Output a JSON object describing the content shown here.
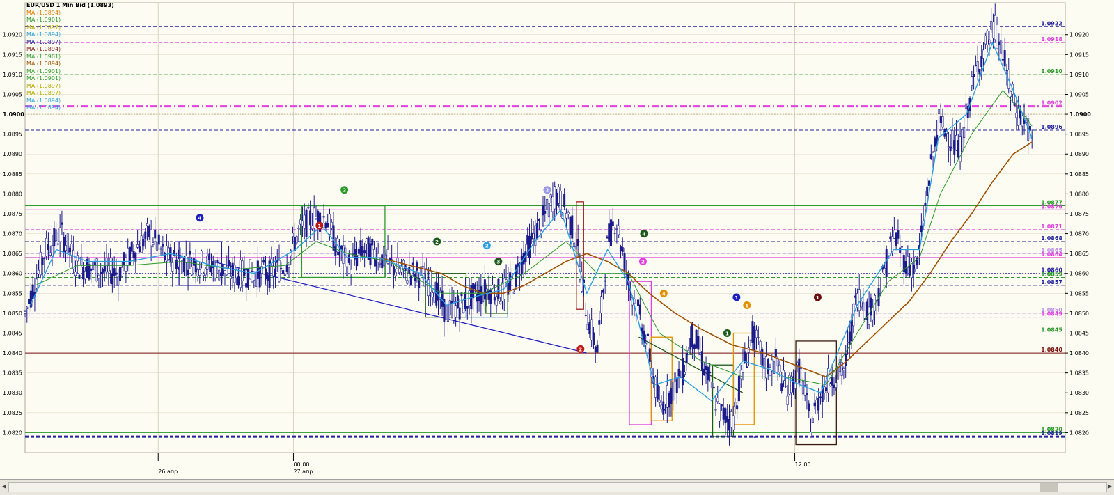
{
  "chart_data": {
    "type": "candlestick",
    "title": "EUR/USD 1 Min Bid (1.0893)",
    "ylim": [
      1.0815,
      1.0928
    ],
    "y_ticks": [
      1.082,
      1.0825,
      1.083,
      1.0835,
      1.084,
      1.0845,
      1.085,
      1.0855,
      1.086,
      1.0865,
      1.087,
      1.0875,
      1.088,
      1.0885,
      1.089,
      1.0895,
      1.09,
      1.0905,
      1.091,
      1.0915,
      1.092
    ],
    "y_tick_labels": [
      "1.0820",
      "1.0825",
      "1.0830",
      "1.0835",
      "1.0840",
      "1.0845",
      "1.0850",
      "1.0855",
      "1.0860",
      "1.0865",
      "1.0870",
      "1.0875",
      "1.0880",
      "1.0885",
      "1.0890",
      "1.0895",
      "1.0900",
      "1.0905",
      "1.0910",
      "1.0915",
      "1.0920"
    ],
    "bold_tick": "1.0900",
    "x_label_groups": [
      {
        "pos": 0.128,
        "labels": [
          "",
          "26 апр"
        ]
      },
      {
        "pos": 0.258,
        "labels": [
          "00:00",
          "27 апр"
        ]
      },
      {
        "pos": 0.74,
        "labels": [
          "12:00",
          ""
        ]
      }
    ],
    "legend": [
      {
        "text": "MA (1.0894)",
        "color": "#e07800"
      },
      {
        "text": "MA (1.0901)",
        "color": "#2a9a2a"
      },
      {
        "text": "MA (1.0897)",
        "color": "#b8a800"
      },
      {
        "text": "MA (1.0894)",
        "color": "#2aa0e0"
      },
      {
        "text": "MA (1.0897)",
        "color": "#2020a0"
      },
      {
        "text": "MA (1.0894)",
        "color": "#8a2020"
      },
      {
        "text": "MA (1.0901)",
        "color": "#2a9a2a"
      },
      {
        "text": "MA (1.0894)",
        "color": "#a05000"
      },
      {
        "text": "MA (1.0901)",
        "color": "#2a9a2a"
      },
      {
        "text": "MA (1.0901)",
        "color": "#2a9a2a"
      },
      {
        "text": "MA (1.0897)",
        "color": "#b8a800"
      },
      {
        "text": "MA (1.0897)",
        "color": "#b8a800"
      },
      {
        "text": "MA (1.0894)",
        "color": "#2aa0e0"
      },
      {
        "text": "MA (1.0894)",
        "color": "#2aa0e0"
      }
    ],
    "levels": [
      {
        "value": 1.0922,
        "label": "1.0922",
        "color": "#2020a0",
        "style": "dash",
        "width": 1
      },
      {
        "value": 1.0918,
        "label": "1.0918",
        "color": "#e040e0",
        "style": "dash",
        "width": 1
      },
      {
        "value": 1.091,
        "label": "1.0910",
        "color": "#2a9a2a",
        "style": "dash",
        "width": 1
      },
      {
        "value": 1.0902,
        "label": "1.0902",
        "color": "#e040e0",
        "style": "dashdot",
        "width": 3
      },
      {
        "value": 1.09,
        "label": "",
        "color": "#c8b090",
        "style": "dot",
        "width": 1
      },
      {
        "value": 1.0896,
        "label": "1.0896",
        "color": "#2020a0",
        "style": "dash",
        "width": 1
      },
      {
        "value": 1.0877,
        "label": "1.0877",
        "color": "#2a9a2a",
        "style": "solid",
        "width": 1
      },
      {
        "value": 1.0876,
        "label": "1.0876",
        "color": "#e040e0",
        "style": "solid",
        "width": 1
      },
      {
        "value": 1.0871,
        "label": "1.0871",
        "color": "#e040e0",
        "style": "dash",
        "width": 1
      },
      {
        "value": 1.0868,
        "label": "1.0868",
        "color": "#2020a0",
        "style": "dash",
        "width": 1
      },
      {
        "value": 1.0865,
        "label": "1.0865",
        "color": "#c090e8",
        "style": "dash",
        "width": 1
      },
      {
        "value": 1.0864,
        "label": "1.0864",
        "color": "#e040e0",
        "style": "solid",
        "width": 1
      },
      {
        "value": 1.086,
        "label": "1.0860",
        "color": "#2020a0",
        "style": "dot",
        "width": 1
      },
      {
        "value": 1.0859,
        "label": "1.0859",
        "color": "#2a9a2a",
        "style": "dash",
        "width": 1
      },
      {
        "value": 1.0857,
        "label": "1.0857",
        "color": "#2020a0",
        "style": "dash",
        "width": 1
      },
      {
        "value": 1.085,
        "label": "1.0850",
        "color": "#c090e8",
        "style": "dash",
        "width": 1
      },
      {
        "value": 1.0849,
        "label": "1.0849",
        "color": "#e040e0",
        "style": "dash",
        "width": 1
      },
      {
        "value": 1.0845,
        "label": "1.0845",
        "color": "#2a9a2a",
        "style": "solid",
        "width": 1
      },
      {
        "value": 1.084,
        "label": "1.0840",
        "color": "#7a1010",
        "style": "solid",
        "width": 1
      },
      {
        "value": 1.082,
        "label": "1.0820",
        "color": "#2a9a2a",
        "style": "solid",
        "width": 1
      },
      {
        "value": 1.0819,
        "label": "1.0819",
        "color": "#2020a0",
        "style": "dash",
        "width": 3
      }
    ],
    "price_path": [
      [
        0.0,
        1.085
      ],
      [
        0.01,
        1.0858
      ],
      [
        0.02,
        1.0866
      ],
      [
        0.035,
        1.087
      ],
      [
        0.05,
        1.0862
      ],
      [
        0.07,
        1.0861
      ],
      [
        0.09,
        1.086
      ],
      [
        0.105,
        1.0866
      ],
      [
        0.12,
        1.087
      ],
      [
        0.135,
        1.0864
      ],
      [
        0.16,
        1.0863
      ],
      [
        0.18,
        1.0862
      ],
      [
        0.195,
        1.086
      ],
      [
        0.215,
        1.086
      ],
      [
        0.235,
        1.086
      ],
      [
        0.25,
        1.0862
      ],
      [
        0.262,
        1.087
      ],
      [
        0.275,
        1.0874
      ],
      [
        0.29,
        1.0874
      ],
      [
        0.3,
        1.0866
      ],
      [
        0.312,
        1.0862
      ],
      [
        0.325,
        1.0866
      ],
      [
        0.338,
        1.0865
      ],
      [
        0.352,
        1.0862
      ],
      [
        0.365,
        1.086
      ],
      [
        0.378,
        1.086
      ],
      [
        0.392,
        1.0857
      ],
      [
        0.405,
        1.085
      ],
      [
        0.418,
        1.0852
      ],
      [
        0.43,
        1.0854
      ],
      [
        0.445,
        1.0856
      ],
      [
        0.458,
        1.0855
      ],
      [
        0.47,
        1.0858
      ],
      [
        0.48,
        1.0865
      ],
      [
        0.495,
        1.0872
      ],
      [
        0.51,
        1.088
      ],
      [
        0.52,
        1.0876
      ],
      [
        0.53,
        1.0868
      ],
      [
        0.54,
        1.085
      ],
      [
        0.55,
        1.084
      ],
      [
        0.56,
        1.0868
      ],
      [
        0.568,
        1.0874
      ],
      [
        0.58,
        1.0858
      ],
      [
        0.59,
        1.085
      ],
      [
        0.6,
        1.084
      ],
      [
        0.61,
        1.0826
      ],
      [
        0.62,
        1.083
      ],
      [
        0.632,
        1.0835
      ],
      [
        0.642,
        1.0845
      ],
      [
        0.655,
        1.0835
      ],
      [
        0.668,
        1.0825
      ],
      [
        0.68,
        1.0823
      ],
      [
        0.69,
        1.0836
      ],
      [
        0.7,
        1.0845
      ],
      [
        0.712,
        1.0836
      ],
      [
        0.722,
        1.0838
      ],
      [
        0.732,
        1.083
      ],
      [
        0.745,
        1.0836
      ],
      [
        0.755,
        1.0822
      ],
      [
        0.765,
        1.083
      ],
      [
        0.775,
        1.0834
      ],
      [
        0.788,
        1.0836
      ],
      [
        0.8,
        1.0855
      ],
      [
        0.812,
        1.085
      ],
      [
        0.822,
        1.0856
      ],
      [
        0.835,
        1.087
      ],
      [
        0.848,
        1.0862
      ],
      [
        0.858,
        1.0862
      ],
      [
        0.868,
        1.0882
      ],
      [
        0.878,
        1.0898
      ],
      [
        0.888,
        1.0895
      ],
      [
        0.898,
        1.089
      ],
      [
        0.905,
        1.09
      ],
      [
        0.915,
        1.0912
      ],
      [
        0.925,
        1.0918
      ],
      [
        0.932,
        1.0922
      ],
      [
        0.94,
        1.0915
      ],
      [
        0.948,
        1.0905
      ],
      [
        0.955,
        1.09
      ],
      [
        0.962,
        1.0898
      ],
      [
        0.968,
        1.0893
      ]
    ],
    "moving_averages": [
      {
        "name": "slow",
        "color": "#a05000",
        "width": 1.6,
        "points": [
          [
            0.34,
            1.0864
          ],
          [
            0.37,
            1.0862
          ],
          [
            0.4,
            1.086
          ],
          [
            0.42,
            1.0857
          ],
          [
            0.44,
            1.0855
          ],
          [
            0.46,
            1.0855
          ],
          [
            0.48,
            1.0857
          ],
          [
            0.5,
            1.086
          ],
          [
            0.52,
            1.0863
          ],
          [
            0.54,
            1.0865
          ],
          [
            0.56,
            1.0863
          ],
          [
            0.58,
            1.086
          ],
          [
            0.6,
            1.0855
          ],
          [
            0.625,
            1.085
          ],
          [
            0.65,
            1.0846
          ],
          [
            0.68,
            1.0842
          ],
          [
            0.71,
            1.084
          ],
          [
            0.74,
            1.0837
          ],
          [
            0.77,
            1.0834
          ],
          [
            0.79,
            1.0838
          ],
          [
            0.81,
            1.0843
          ],
          [
            0.83,
            1.0848
          ],
          [
            0.85,
            1.0853
          ],
          [
            0.87,
            1.086
          ],
          [
            0.89,
            1.0868
          ],
          [
            0.91,
            1.0875
          ],
          [
            0.93,
            1.0883
          ],
          [
            0.95,
            1.089
          ],
          [
            0.968,
            1.0893
          ]
        ]
      },
      {
        "name": "mid",
        "color": "#2a9a2a",
        "width": 1,
        "points": [
          [
            0.01,
            1.0857
          ],
          [
            0.05,
            1.0862
          ],
          [
            0.1,
            1.0862
          ],
          [
            0.15,
            1.0863
          ],
          [
            0.2,
            1.0861
          ],
          [
            0.25,
            1.0862
          ],
          [
            0.28,
            1.0868
          ],
          [
            0.31,
            1.0865
          ],
          [
            0.35,
            1.0863
          ],
          [
            0.4,
            1.0855
          ],
          [
            0.44,
            1.0855
          ],
          [
            0.48,
            1.086
          ],
          [
            0.52,
            1.0868
          ],
          [
            0.55,
            1.086
          ],
          [
            0.58,
            1.086
          ],
          [
            0.61,
            1.0845
          ],
          [
            0.65,
            1.0838
          ],
          [
            0.69,
            1.0834
          ],
          [
            0.73,
            1.0834
          ],
          [
            0.77,
            1.0832
          ],
          [
            0.8,
            1.0845
          ],
          [
            0.83,
            1.0858
          ],
          [
            0.86,
            1.0864
          ],
          [
            0.88,
            1.088
          ],
          [
            0.91,
            1.0895
          ],
          [
            0.94,
            1.0906
          ],
          [
            0.96,
            1.09
          ],
          [
            0.968,
            1.0897
          ]
        ]
      },
      {
        "name": "fast",
        "color": "#2aa0e0",
        "width": 1.4,
        "points": [
          [
            0.005,
            1.0852
          ],
          [
            0.03,
            1.0866
          ],
          [
            0.06,
            1.0863
          ],
          [
            0.1,
            1.0863
          ],
          [
            0.14,
            1.0865
          ],
          [
            0.18,
            1.0862
          ],
          [
            0.22,
            1.086
          ],
          [
            0.26,
            1.0866
          ],
          [
            0.285,
            1.0872
          ],
          [
            0.31,
            1.0864
          ],
          [
            0.34,
            1.0864
          ],
          [
            0.38,
            1.086
          ],
          [
            0.405,
            1.0852
          ],
          [
            0.43,
            1.0854
          ],
          [
            0.46,
            1.0856
          ],
          [
            0.49,
            1.0868
          ],
          [
            0.515,
            1.0876
          ],
          [
            0.54,
            1.0855
          ],
          [
            0.56,
            1.0866
          ],
          [
            0.58,
            1.0858
          ],
          [
            0.605,
            1.0832
          ],
          [
            0.63,
            1.0834
          ],
          [
            0.66,
            1.0828
          ],
          [
            0.69,
            1.0838
          ],
          [
            0.715,
            1.0836
          ],
          [
            0.745,
            1.0832
          ],
          [
            0.765,
            1.083
          ],
          [
            0.8,
            1.0852
          ],
          [
            0.835,
            1.0866
          ],
          [
            0.86,
            1.0866
          ],
          [
            0.878,
            1.0894
          ],
          [
            0.905,
            1.09
          ],
          [
            0.93,
            1.0918
          ],
          [
            0.95,
            1.0906
          ],
          [
            0.968,
            1.0894
          ]
        ]
      }
    ],
    "boxes": [
      {
        "x0": 0.148,
        "x1": 0.189,
        "y0": 1.0857,
        "y1": 1.0868,
        "color": "#2020a0"
      },
      {
        "x0": 0.266,
        "x1": 0.346,
        "y0": 1.0859,
        "y1": 1.0877,
        "color": "#2a9a2a"
      },
      {
        "x0": 0.385,
        "x1": 0.424,
        "y0": 1.0849,
        "y1": 1.086,
        "color": "#1a5a1a"
      },
      {
        "x0": 0.424,
        "x1": 0.464,
        "y0": 1.0849,
        "y1": 1.0857,
        "color": "#2aa0e0"
      },
      {
        "x0": 0.443,
        "x1": 0.464,
        "y0": 1.085,
        "y1": 1.0857,
        "color": "#1a5a1a"
      },
      {
        "x0": 0.497,
        "x1": 0.504,
        "y0": 1.0872,
        "y1": 1.0876,
        "color": "#8a8ae0"
      },
      {
        "x0": 0.53,
        "x1": 0.537,
        "y0": 1.0851,
        "y1": 1.0878,
        "color": "#a02020"
      },
      {
        "x0": 0.581,
        "x1": 0.602,
        "y0": 1.0822,
        "y1": 1.0858,
        "color": "#e040e0"
      },
      {
        "x0": 0.602,
        "x1": 0.622,
        "y0": 1.0823,
        "y1": 1.0844,
        "color": "#e09000"
      },
      {
        "x0": 0.661,
        "x1": 0.681,
        "y0": 1.0819,
        "y1": 1.0837,
        "color": "#1a5a1a"
      },
      {
        "x0": 0.681,
        "x1": 0.701,
        "y0": 1.0822,
        "y1": 1.0845,
        "color": "#e09000"
      },
      {
        "x0": 0.701,
        "x1": 0.702,
        "y0": 1.0819,
        "y1": 1.0819,
        "color": "#2020a0"
      },
      {
        "x0": 0.741,
        "x1": 0.78,
        "y0": 1.0817,
        "y1": 1.0843,
        "color": "#3a1a10"
      }
    ],
    "trendlines": [
      {
        "x0": 0.18,
        "y0": 1.0863,
        "x1": 0.54,
        "y1": 1.084,
        "color": "#2020c0"
      },
      {
        "x0": 0.59,
        "y0": 1.0844,
        "x1": 0.69,
        "y1": 1.083,
        "color": "#1a5a1a"
      }
    ],
    "markers": [
      {
        "x": 0.168,
        "y": 1.0874,
        "num": "4",
        "color": "#2020c0"
      },
      {
        "x": 0.283,
        "y": 1.0872,
        "num": "1",
        "color": "#c01818"
      },
      {
        "x": 0.307,
        "y": 1.0881,
        "num": "2",
        "color": "#2a9a2a"
      },
      {
        "x": 0.396,
        "y": 1.0868,
        "num": "2",
        "color": "#1a5a1a"
      },
      {
        "x": 0.444,
        "y": 1.0867,
        "num": "2",
        "color": "#2aa0e0"
      },
      {
        "x": 0.455,
        "y": 1.0863,
        "num": "3",
        "color": "#1a5a1a"
      },
      {
        "x": 0.502,
        "y": 1.0881,
        "num": "2",
        "color": "#9a9ae8"
      },
      {
        "x": 0.534,
        "y": 1.0841,
        "num": "2",
        "color": "#c01818"
      },
      {
        "x": 0.595,
        "y": 1.087,
        "num": "4",
        "color": "#1a5a1a"
      },
      {
        "x": 0.594,
        "y": 1.0863,
        "num": "2",
        "color": "#e040e0"
      },
      {
        "x": 0.614,
        "y": 1.0855,
        "num": "4",
        "color": "#e09000"
      },
      {
        "x": 0.684,
        "y": 1.0854,
        "num": "1",
        "color": "#2020c0"
      },
      {
        "x": 0.694,
        "y": 1.0852,
        "num": "1",
        "color": "#e09000"
      },
      {
        "x": 0.675,
        "y": 1.0845,
        "num": "1",
        "color": "#1a5a1a"
      },
      {
        "x": 0.762,
        "y": 1.0854,
        "num": "1",
        "color": "#6a1010"
      }
    ]
  },
  "colors": {
    "background": "#fdfcf2",
    "candle": "#1a1a8a",
    "grid": "#e0dcc8",
    "axis_text": "#000000"
  }
}
